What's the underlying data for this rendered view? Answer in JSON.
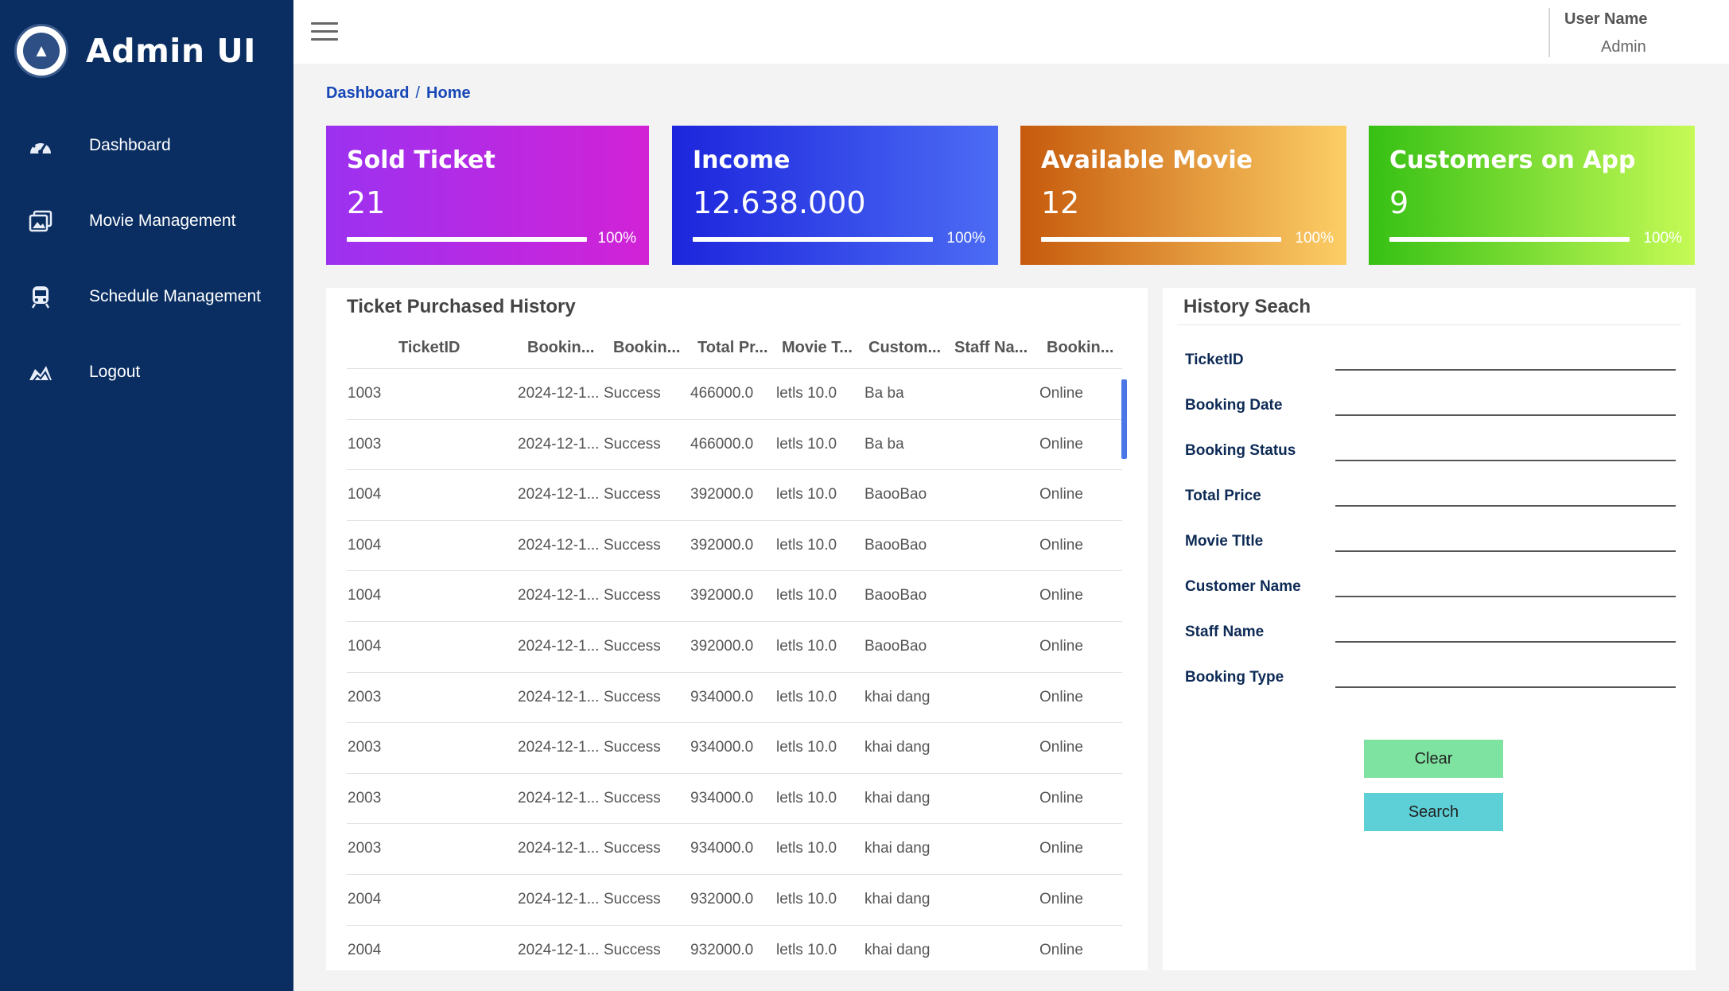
{
  "app": {
    "title": "Admin UI"
  },
  "sidebar": {
    "items": [
      {
        "label": "Dashboard",
        "icon": "gauge-icon"
      },
      {
        "label": "Movie Management",
        "icon": "image-gallery-icon"
      },
      {
        "label": "Schedule Management",
        "icon": "train-icon"
      },
      {
        "label": "Logout",
        "icon": "logout-icon"
      }
    ]
  },
  "topbar": {
    "user_label": "User Name",
    "user_role": "Admin"
  },
  "breadcrumb": {
    "first": "Dashboard",
    "separator": "/",
    "current": "Home"
  },
  "cards": [
    {
      "title": "Sold Ticket",
      "value": "21",
      "progress": 100,
      "progress_label": "100%"
    },
    {
      "title": "Income",
      "value": "12.638.000",
      "progress": 100,
      "progress_label": "100%"
    },
    {
      "title": "Available Movie",
      "value": "12",
      "progress": 100,
      "progress_label": "100%"
    },
    {
      "title": "Customers on App",
      "value": "9",
      "progress": 100,
      "progress_label": "100%"
    }
  ],
  "history": {
    "title": "Ticket Purchased History",
    "columns": [
      "TicketID",
      "Bookin...",
      "Bookin...",
      "Total Pr...",
      "Movie T...",
      "Custom...",
      "Staff Na...",
      "Bookin..."
    ],
    "rows": [
      [
        "1003",
        "2024-12-1...",
        "Success",
        "466000.0",
        "letls 10.0",
        "Ba ba",
        "",
        "Online"
      ],
      [
        "1003",
        "2024-12-1...",
        "Success",
        "466000.0",
        "letls 10.0",
        "Ba ba",
        "",
        "Online"
      ],
      [
        "1004",
        "2024-12-1...",
        "Success",
        "392000.0",
        "letls 10.0",
        "BaooBao",
        "",
        "Online"
      ],
      [
        "1004",
        "2024-12-1...",
        "Success",
        "392000.0",
        "letls 10.0",
        "BaooBao",
        "",
        "Online"
      ],
      [
        "1004",
        "2024-12-1...",
        "Success",
        "392000.0",
        "letls 10.0",
        "BaooBao",
        "",
        "Online"
      ],
      [
        "1004",
        "2024-12-1...",
        "Success",
        "392000.0",
        "letls 10.0",
        "BaooBao",
        "",
        "Online"
      ],
      [
        "2003",
        "2024-12-1...",
        "Success",
        "934000.0",
        "letls 10.0",
        "khai dang",
        "",
        "Online"
      ],
      [
        "2003",
        "2024-12-1...",
        "Success",
        "934000.0",
        "letls 10.0",
        "khai dang",
        "",
        "Online"
      ],
      [
        "2003",
        "2024-12-1...",
        "Success",
        "934000.0",
        "letls 10.0",
        "khai dang",
        "",
        "Online"
      ],
      [
        "2003",
        "2024-12-1...",
        "Success",
        "934000.0",
        "letls 10.0",
        "khai dang",
        "",
        "Online"
      ],
      [
        "2004",
        "2024-12-1...",
        "Success",
        "932000.0",
        "letls 10.0",
        "khai dang",
        "",
        "Online"
      ],
      [
        "2004",
        "2024-12-1...",
        "Success",
        "932000.0",
        "letls 10.0",
        "khai dang",
        "",
        "Online"
      ]
    ]
  },
  "search": {
    "title": "History Seach",
    "fields": [
      {
        "label": "TicketID",
        "value": ""
      },
      {
        "label": "Booking Date",
        "value": ""
      },
      {
        "label": "Booking Status",
        "value": ""
      },
      {
        "label": "Total Price",
        "value": ""
      },
      {
        "label": "Movie Tltle",
        "value": ""
      },
      {
        "label": "Customer Name",
        "value": ""
      },
      {
        "label": "Staff Name",
        "value": ""
      },
      {
        "label": "Booking Type",
        "value": ""
      }
    ],
    "clear_label": "Clear",
    "search_label": "Search"
  },
  "colors": {
    "sidebar": "#0a2e62",
    "link": "#1747b7",
    "clear_button": "#7ee3a0",
    "search_button": "#5dcfd6"
  }
}
